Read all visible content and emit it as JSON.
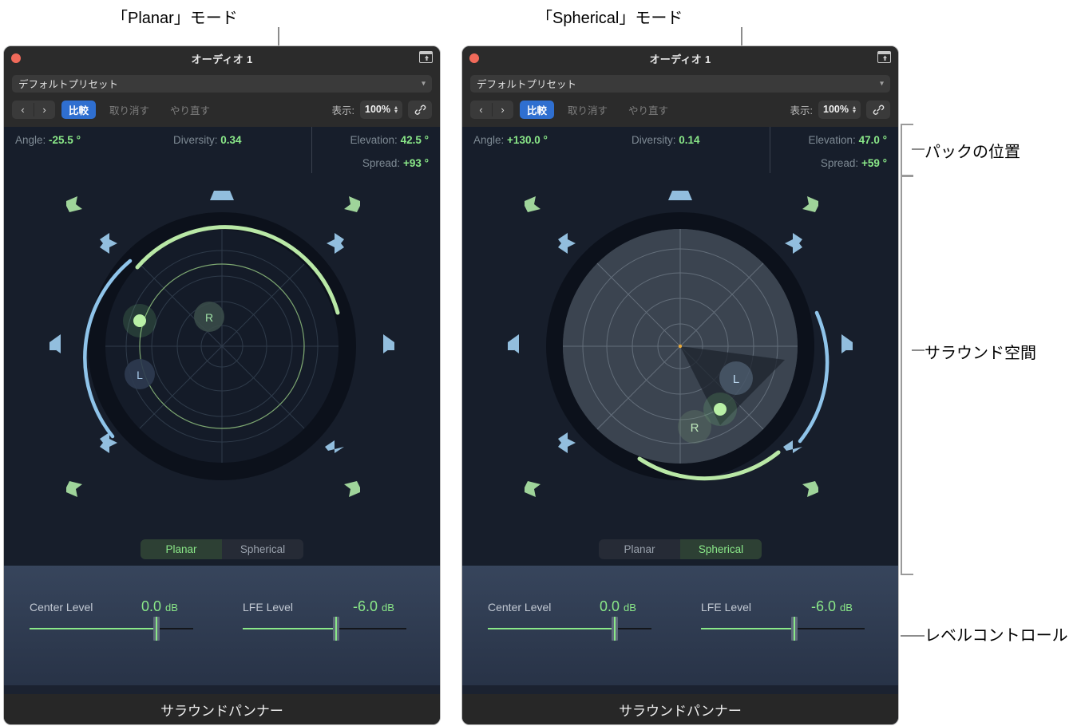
{
  "annotations": {
    "planar_mode": "「Planar」モード",
    "spherical_mode": "「Spherical」モード",
    "puck_position": "パックの位置",
    "surround_space": "サラウンド空間",
    "level_control": "レベルコントロール"
  },
  "colors": {
    "accent_green": "#8ae888",
    "accent_blue": "#8fc4ea",
    "compare_blue": "#2f6fd0",
    "close_red": "#f06a5a",
    "panel_bg": "#171e2b",
    "level_bg": "#37455c"
  },
  "panels": [
    {
      "id": "planar",
      "titlebar": {
        "title": "オーディオ 1",
        "close_icon": "close-dot-icon",
        "expand_icon": "expand-window-icon"
      },
      "preset": {
        "value": "デフォルトプリセット",
        "chevron_icon": "chevron-down-icon"
      },
      "toolbar": {
        "prev_icon": "chevron-left-icon",
        "next_icon": "chevron-right-icon",
        "compare": "比較",
        "undo": "取り消す",
        "redo": "やり直す",
        "view_label": "表示:",
        "view_value": "100%",
        "stepper_icon": "stepper-updown-icon",
        "link_icon": "link-chain-icon"
      },
      "params": {
        "angle_label": "Angle:",
        "angle_value": "-25.5 °",
        "diversity_label": "Diversity:",
        "diversity_value": "0.34",
        "elevation_label": "Elevation:",
        "elevation_value": "42.5 °",
        "spread_label": "Spread:",
        "spread_value": "+93 °"
      },
      "panner": {
        "puck_label": "puck",
        "marker_l": "L",
        "marker_r": "R"
      },
      "mode": {
        "planar": "Planar",
        "spherical": "Spherical",
        "selected": "Planar"
      },
      "levels": [
        {
          "label": "Center Level",
          "value": "0.0",
          "unit": "dB"
        },
        {
          "label": "LFE Level",
          "value": "-6.0",
          "unit": "dB"
        }
      ],
      "footer": "サラウンドパンナー"
    },
    {
      "id": "spherical",
      "titlebar": {
        "title": "オーディオ 1",
        "close_icon": "close-dot-icon",
        "expand_icon": "expand-window-icon"
      },
      "preset": {
        "value": "デフォルトプリセット",
        "chevron_icon": "chevron-down-icon"
      },
      "toolbar": {
        "prev_icon": "chevron-left-icon",
        "next_icon": "chevron-right-icon",
        "compare": "比較",
        "undo": "取り消す",
        "redo": "やり直す",
        "view_label": "表示:",
        "view_value": "100%",
        "stepper_icon": "stepper-updown-icon",
        "link_icon": "link-chain-icon"
      },
      "params": {
        "angle_label": "Angle:",
        "angle_value": "+130.0 °",
        "diversity_label": "Diversity:",
        "diversity_value": "0.14",
        "elevation_label": "Elevation:",
        "elevation_value": "47.0 °",
        "spread_label": "Spread:",
        "spread_value": "+59 °"
      },
      "panner": {
        "puck_label": "puck",
        "marker_l": "L",
        "marker_r": "R"
      },
      "mode": {
        "planar": "Planar",
        "spherical": "Spherical",
        "selected": "Spherical"
      },
      "levels": [
        {
          "label": "Center Level",
          "value": "0.0",
          "unit": "dB"
        },
        {
          "label": "LFE Level",
          "value": "-6.0",
          "unit": "dB"
        }
      ],
      "footer": "サラウンドパンナー"
    }
  ]
}
